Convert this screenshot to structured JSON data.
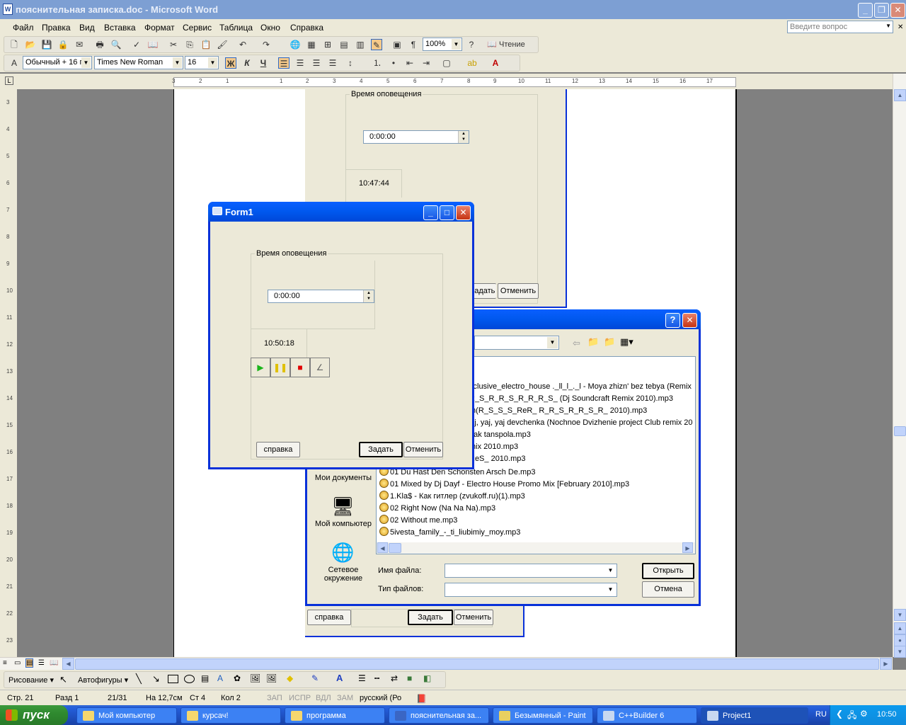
{
  "word": {
    "title": "пояснительная записка.doc - Microsoft Word",
    "title_icon": "W",
    "menu": [
      "Файл",
      "Правка",
      "Вид",
      "Вставка",
      "Формат",
      "Сервис",
      "Таблица",
      "Окно",
      "Справка"
    ],
    "help_placeholder": "Введите вопрос",
    "zoom": "100%",
    "read_button": "Чтение",
    "style": "Обычный + 16 г",
    "font": "Times New Roman",
    "font_size": "16",
    "bold": "Ж",
    "italic": "К",
    "underline": "Ч",
    "font_color_glyph": "A",
    "hruler_numbers": [
      "3",
      "2",
      "1",
      "1",
      "2",
      "3",
      "4",
      "5",
      "6",
      "7",
      "8",
      "9",
      "10",
      "11",
      "12",
      "13",
      "14",
      "15",
      "16",
      "17"
    ],
    "vruler_numbers": [
      "3",
      "4",
      "5",
      "6",
      "7",
      "8",
      "9",
      "10",
      "11",
      "12",
      "13",
      "14",
      "15",
      "16",
      "17",
      "18",
      "19",
      "20",
      "21",
      "22",
      "23"
    ]
  },
  "bg_form": {
    "group_label": "Время оповещения",
    "time_value": "0:00:00",
    "clock": "10:47:44",
    "ok_button": "Задать",
    "cancel_button": "Отменить"
  },
  "bg_form2": {
    "help_button": "справка",
    "ok_button": "Задать",
    "cancel_button": "Отменить"
  },
  "form1": {
    "title": "Form1",
    "group_label": "Время оповещения",
    "time_value": "0:00:00",
    "clock": "10:50:18",
    "help_button": "справка",
    "ok_button": "Задать",
    "cancel_button": "Отменить"
  },
  "open_dialog": {
    "help_glyph": "?",
    "close_glyph": "✕",
    "places": [
      "Мои документы",
      "Мой компьютер",
      "Сетевое окружение"
    ],
    "files": [
      "xclusive_electro_house ._ll_l_._l - Moya zhizn' bez tebya (Remix",
      "R_S_R_R_S_R_R_R_S_ (Dj Soundcraft Remix 2010).mp3",
      "m(R_S_S_S_ReR_ R_R_S_R_R_S_R_ 2010).mp3",
      "Aj, yaj, yaj devchenka (Nochnoe Dvizhenie project Club remix 20",
      "eak tanspola.mp3",
      "mix 2010.mp3",
      "ReS_ 2010.mp3",
      "01 Du Hast Den Schonsten Arsch De.mp3",
      "01 Mixed by Dj Dayf - Electro House Promo Mix [February 2010].mp3",
      "1.Kla$ - Как гитлер (zvukoff.ru)(1).mp3",
      "02 Right Now (Na Na Na).mp3",
      "02 Without me.mp3",
      "5ivesta_family_-_ti_liubimiy_moy.mp3"
    ],
    "filename_label": "Имя файла:",
    "filetype_label": "Тип файлов:",
    "open_button": "Открыть",
    "cancel_button": "Отмена"
  },
  "drawing": {
    "draw_menu": "Рисование",
    "autoshapes_menu": "Автофигуры"
  },
  "status": {
    "page": "Стр. 21",
    "section": "Разд 1",
    "pages": "21/31",
    "at": "На 12,7см",
    "line": "Ст 4",
    "col": "Кол 2",
    "rec": "ЗАП",
    "trk": "ИСПР",
    "ext": "ВДЛ",
    "ovr": "ЗАМ",
    "lang": "русский (Ро"
  },
  "taskbar": {
    "start": "пуск",
    "tasks": [
      "Мой компьютер",
      "курсач!",
      "программа",
      "пояснительная за...",
      "Безымянный - Paint",
      "C++Builder 6",
      "Project1"
    ],
    "lang": "RU",
    "clock": "10:50"
  }
}
